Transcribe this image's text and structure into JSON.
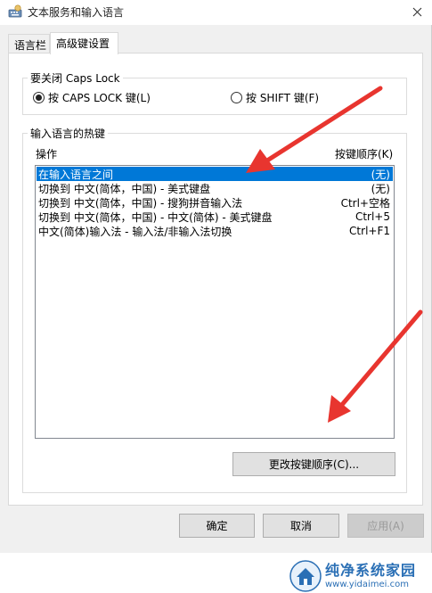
{
  "window": {
    "title": "文本服务和输入语言"
  },
  "tabs": [
    {
      "label": "语言栏"
    },
    {
      "label": "高级键设置"
    }
  ],
  "caps_lock_group": {
    "title": "要关闭 Caps Lock",
    "option_caps": "按 CAPS LOCK 键(L)",
    "option_shift": "按 SHIFT 键(F)",
    "selected": "caps"
  },
  "hotkeys_group": {
    "title": "输入语言的热键",
    "col_action": "操作",
    "col_sequence": "按键顺序(K)",
    "rows": [
      {
        "action": "在输入语言之间",
        "keys": "(无)",
        "selected": true
      },
      {
        "action": "切换到 中文(简体，中国) - 美式键盘",
        "keys": "(无)"
      },
      {
        "action": "切换到 中文(简体，中国) - 搜狗拼音输入法",
        "keys": "Ctrl+空格"
      },
      {
        "action": "切换到 中文(简体，中国) - 中文(简体) - 美式键盘",
        "keys": "Ctrl+5"
      },
      {
        "action": "中文(简体)输入法 - 输入法/非输入法切换",
        "keys": "Ctrl+F1"
      }
    ],
    "change_sequence_button": "更改按键顺序(C)..."
  },
  "buttons": {
    "ok": "确定",
    "cancel": "取消",
    "apply": "应用(A)"
  },
  "watermark": {
    "title": "纯净系统家园",
    "url": "www.yidaimei.com"
  },
  "colors": {
    "selection": "#0078d7",
    "annotation_arrow": "#e8352f",
    "watermark": "#2a6fb5"
  },
  "icons": {
    "app": "keyboard-globe-icon",
    "close": "close-icon",
    "watermark_logo": "house-logo-icon"
  }
}
